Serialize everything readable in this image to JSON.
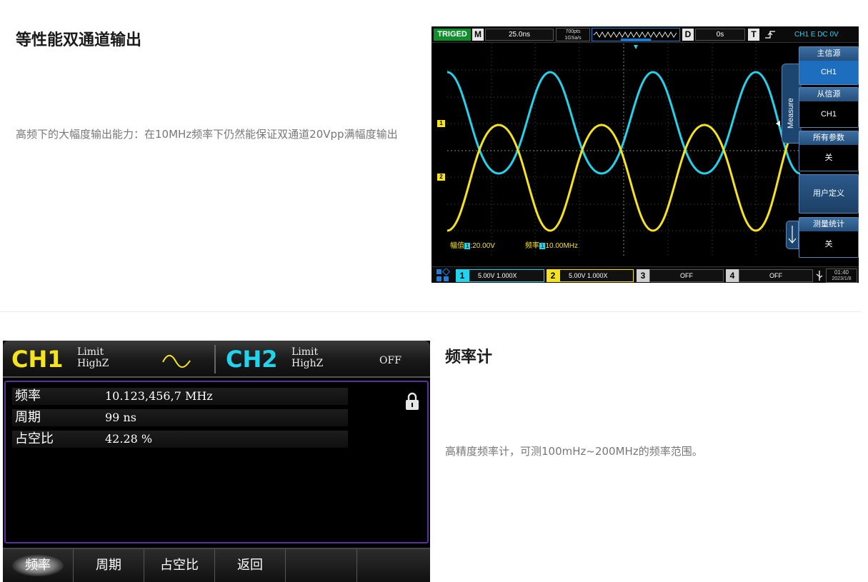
{
  "section1": {
    "title": "等性能双通道输出",
    "description": "高频下的大幅度输出能力：在10MHz频率下仍然能保证双通道20Vpp满幅度输出"
  },
  "section2": {
    "title": "频率计",
    "description": "高精度频率计，可测100mHz~200MHz的频率范围。"
  },
  "oscilloscope": {
    "status": "TRIGED",
    "timebase_label": "M",
    "timebase_value": "25.0ns",
    "points": "700pts",
    "sample_rate": "1GSa/s",
    "delay_label": "D",
    "delay_value": "0s",
    "trigger_label": "T",
    "trigger_desc": "CH1 E DC 0V",
    "tab_label": "Measure",
    "side_menu": [
      {
        "title": "主信源",
        "value": "CH1"
      },
      {
        "title": "从信源",
        "value": "CH1"
      },
      {
        "title": "所有参数",
        "value": "关"
      },
      {
        "title": "用户定义",
        "value": ""
      },
      {
        "title": "测量统计",
        "value": "关"
      }
    ],
    "measure_amp_label": "幅值",
    "measure_amp_value": ":20.00V",
    "measure_freq_label": "频率",
    "measure_freq_value": "10.00MHz",
    "ch1_marker": "1",
    "ch2_marker": "2",
    "channels": [
      {
        "num": "1",
        "setting": "5.00V 1.000X",
        "color": "#22d3ee"
      },
      {
        "num": "2",
        "setting": "5.00V 1.000X",
        "color": "#f5e31c"
      },
      {
        "num": "3",
        "setting": "OFF",
        "color": "#d0d0d0"
      },
      {
        "num": "4",
        "setting": "OFF",
        "color": "#d0d0d0"
      }
    ],
    "time": "01:40",
    "date": "2023/1/8"
  },
  "generator": {
    "ch1": "CH1",
    "ch1_limit": "Limit",
    "ch1_load": "HighZ",
    "ch2": "CH2",
    "ch2_limit": "Limit",
    "ch2_load": "HighZ",
    "ch2_state": "OFF",
    "rows": [
      {
        "label": "频率",
        "value": "10.123,456,7 MHz"
      },
      {
        "label": "周期",
        "value": "99 ns"
      },
      {
        "label": "占空比",
        "value": "42.28 %"
      }
    ],
    "softkeys": [
      "频率",
      "周期",
      "占空比",
      "返回",
      "",
      ""
    ]
  },
  "colors": {
    "ch1": "#22d3ee",
    "ch2": "#f5e31c",
    "trig_green": "#0e8f2c",
    "accent_blue": "#1e6ec0"
  }
}
